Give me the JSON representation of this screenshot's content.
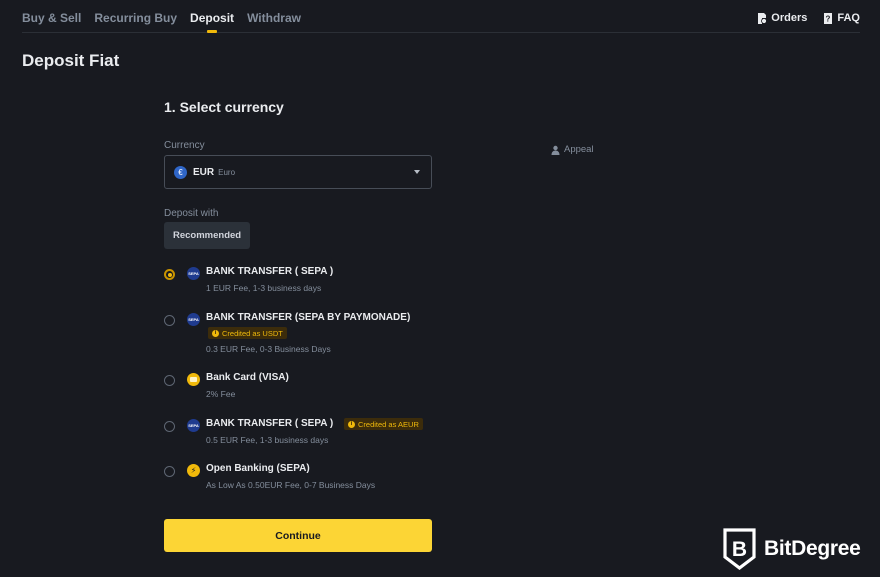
{
  "nav": {
    "tabs": [
      {
        "label": "Buy & Sell",
        "active": false
      },
      {
        "label": "Recurring Buy",
        "active": false
      },
      {
        "label": "Deposit",
        "active": true
      },
      {
        "label": "Withdraw",
        "active": false
      }
    ],
    "right_links": [
      {
        "label": "Orders",
        "icon": "orders-icon"
      },
      {
        "label": "FAQ",
        "icon": "faq-icon"
      }
    ]
  },
  "page": {
    "title": "Deposit Fiat"
  },
  "form": {
    "step_title": "1. Select currency",
    "currency_label": "Currency",
    "currency": {
      "icon": "euro-icon",
      "symbol": "€",
      "code": "EUR",
      "name": "Euro"
    },
    "deposit_with_label": "Deposit with",
    "recommended_label": "Recommended",
    "options": [
      {
        "title": "BANK TRANSFER ( SEPA )",
        "subtitle": "1 EUR Fee, 1-3 business days",
        "icon": "sepa-icon",
        "icon_text": "SEPA",
        "selected": true,
        "badge": null
      },
      {
        "title": "BANK TRANSFER (SEPA BY PAYMONADE)",
        "subtitle": "0.3 EUR Fee, 0-3 Business Days",
        "icon": "sepa-icon",
        "icon_text": "SEPA",
        "selected": false,
        "badge": "Credited as USDT"
      },
      {
        "title": "Bank Card (VISA)",
        "subtitle": "2% Fee",
        "icon": "bank-card-icon",
        "icon_text": "",
        "selected": false,
        "badge": null
      },
      {
        "title": "BANK TRANSFER ( SEPA )",
        "subtitle": "0.5 EUR Fee, 1-3 business days",
        "icon": "sepa-icon",
        "icon_text": "SEPA",
        "selected": false,
        "badge": "Credited as AEUR"
      },
      {
        "title": "Open Banking (SEPA)",
        "subtitle": "As Low As 0.50EUR Fee, 0-7 Business Days",
        "icon": "lightning-icon",
        "icon_text": "⚡",
        "selected": false,
        "badge": null
      }
    ],
    "continue_label": "Continue"
  },
  "aside": {
    "appeal_label": "Appeal"
  },
  "watermark": {
    "brand": "BitDegree"
  },
  "colors": {
    "accent": "#f0b90b",
    "button": "#fcd535",
    "background": "#181a20"
  }
}
